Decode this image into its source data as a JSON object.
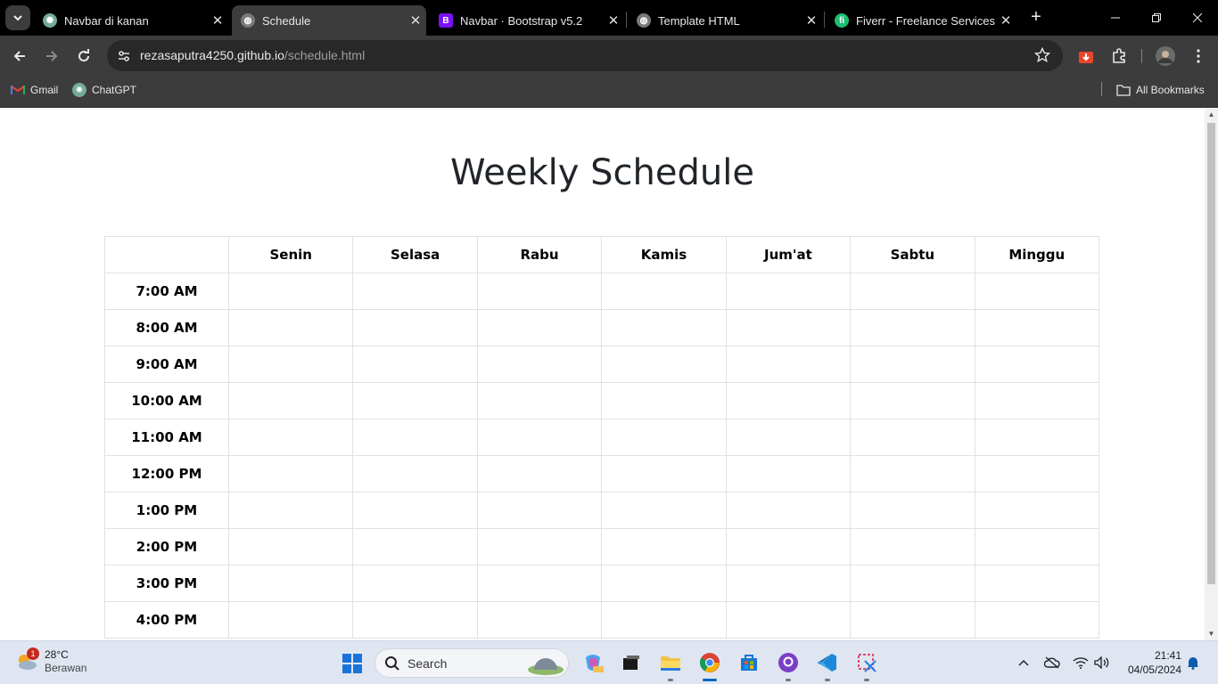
{
  "browser": {
    "tabs": [
      {
        "title": "Navbar di kanan",
        "icon": "chatgpt-icon",
        "active": false
      },
      {
        "title": "Schedule",
        "icon": "globe-icon",
        "active": true
      },
      {
        "title": "Navbar · Bootstrap v5.2",
        "icon": "bootstrap-icon",
        "active": false
      },
      {
        "title": "Template HTML",
        "icon": "globe-icon",
        "active": false
      },
      {
        "title": "Fiverr - Freelance Services M",
        "icon": "fiverr-icon",
        "active": false
      }
    ],
    "new_tab": "+",
    "address": {
      "host": "rezasaputra4250.github.io",
      "path": "/schedule.html"
    },
    "bookmarks": [
      {
        "label": "Gmail",
        "icon": "gmail-icon"
      },
      {
        "label": "ChatGPT",
        "icon": "chatgpt-icon"
      }
    ],
    "all_bookmarks": "All Bookmarks"
  },
  "page": {
    "title": "Weekly Schedule",
    "days": [
      "Senin",
      "Selasa",
      "Rabu",
      "Kamis",
      "Jum'at",
      "Sabtu",
      "Minggu"
    ],
    "times": [
      "7:00 AM",
      "8:00 AM",
      "9:00 AM",
      "10:00 AM",
      "11:00 AM",
      "12:00 PM",
      "1:00 PM",
      "2:00 PM",
      "3:00 PM",
      "4:00 PM"
    ]
  },
  "taskbar": {
    "weather": {
      "temp": "28°C",
      "condition": "Berawan",
      "badge": "1"
    },
    "search": "Search",
    "clock": {
      "time": "21:41",
      "date": "04/05/2024"
    }
  },
  "colors": {
    "tab_bg": "#000000",
    "toolbar_bg": "#3c3c3c",
    "table_border": "#dee2e6",
    "title": "#212529",
    "taskbar_bg": "#dfe6f1"
  }
}
